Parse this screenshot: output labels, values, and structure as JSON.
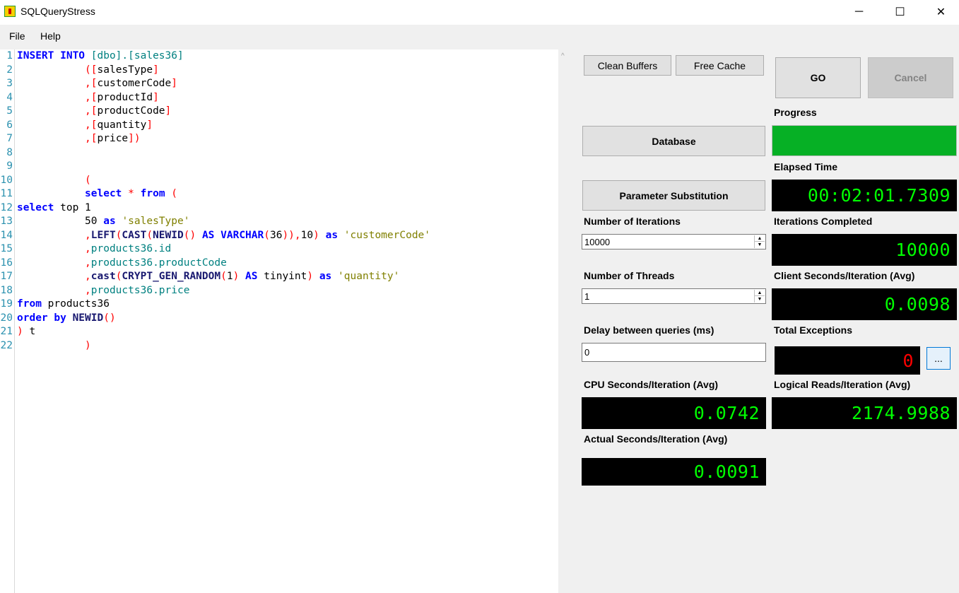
{
  "window": {
    "title": "SQLQueryStress",
    "minimize": "─",
    "maximize": "☐",
    "close": "✕"
  },
  "menu": {
    "file": "File",
    "help": "Help"
  },
  "editor": {
    "line_numbers": [
      "1",
      "2",
      "3",
      "4",
      "5",
      "6",
      "7",
      "8",
      "9",
      "10",
      "11",
      "12",
      "13",
      "14",
      "15",
      "16",
      "17",
      "18",
      "19",
      "20",
      "21",
      "22"
    ]
  },
  "buttons": {
    "clean_buffers": "Clean Buffers",
    "free_cache": "Free Cache",
    "go": "GO",
    "cancel": "Cancel",
    "database": "Database",
    "parameter_substitution": "Parameter Substitution",
    "exceptions_details": "..."
  },
  "labels": {
    "progress": "Progress",
    "elapsed_time": "Elapsed Time",
    "number_of_iterations": "Number of Iterations",
    "iterations_completed": "Iterations Completed",
    "number_of_threads": "Number of Threads",
    "client_seconds": "Client Seconds/Iteration (Avg)",
    "delay_between_queries": "Delay between queries (ms)",
    "total_exceptions": "Total Exceptions",
    "cpu_seconds": "CPU Seconds/Iteration (Avg)",
    "logical_reads": "Logical Reads/Iteration (Avg)",
    "actual_seconds": "Actual Seconds/Iteration (Avg)"
  },
  "inputs": {
    "number_of_iterations": "10000",
    "number_of_threads": "1",
    "delay_between_queries": "0"
  },
  "displays": {
    "elapsed_time": "00:02:01.7309",
    "iterations_completed": "10000",
    "client_seconds": "0.0098",
    "total_exceptions": "0",
    "cpu_seconds": "0.0742",
    "logical_reads": "2174.9988",
    "actual_seconds": "0.0091"
  },
  "progress": {
    "fraction": 1.0
  },
  "colors": {
    "progress_fill": "#06b025",
    "display_text": "#00ff00",
    "exceptions_text": "#ff0000"
  }
}
